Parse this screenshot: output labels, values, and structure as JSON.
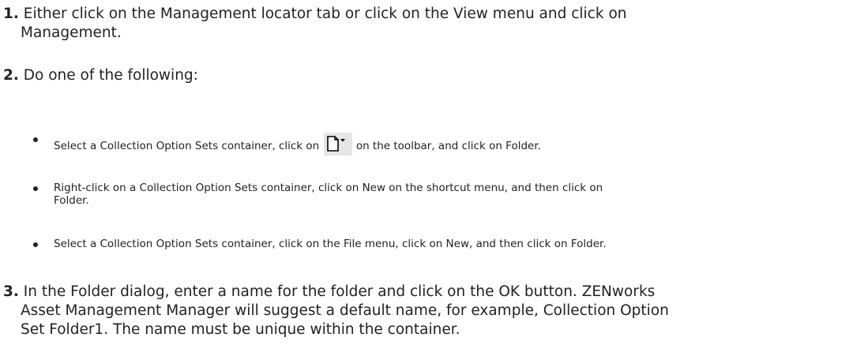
{
  "steps": [
    {
      "number": "1.",
      "line1": "Either click on the Management locator tab or click on the View menu and click on",
      "line2": "Management."
    },
    {
      "number": "2.",
      "text": "Do one of the following:"
    },
    {
      "number": "3.",
      "line1": "In the Folder dialog, enter a name for the folder and click on the OK button. ZENworks",
      "line2": "Asset Management Manager will suggest a default name, for example, Collection Option",
      "line3": "Set Folder1. The name must be unique within the container."
    }
  ],
  "bullets": [
    {
      "before": "Select a Collection Option Sets container, click on",
      "icon": "new-document-dropdown-icon",
      "after": "on the toolbar, and click on Folder."
    },
    {
      "line1": "Right-click on a Collection Option Sets container, click on New on the shortcut menu, and then click on",
      "line2": "Folder."
    },
    {
      "text": "Select a Collection Option Sets container, click on the File menu, click on New, and then click on Folder."
    }
  ]
}
